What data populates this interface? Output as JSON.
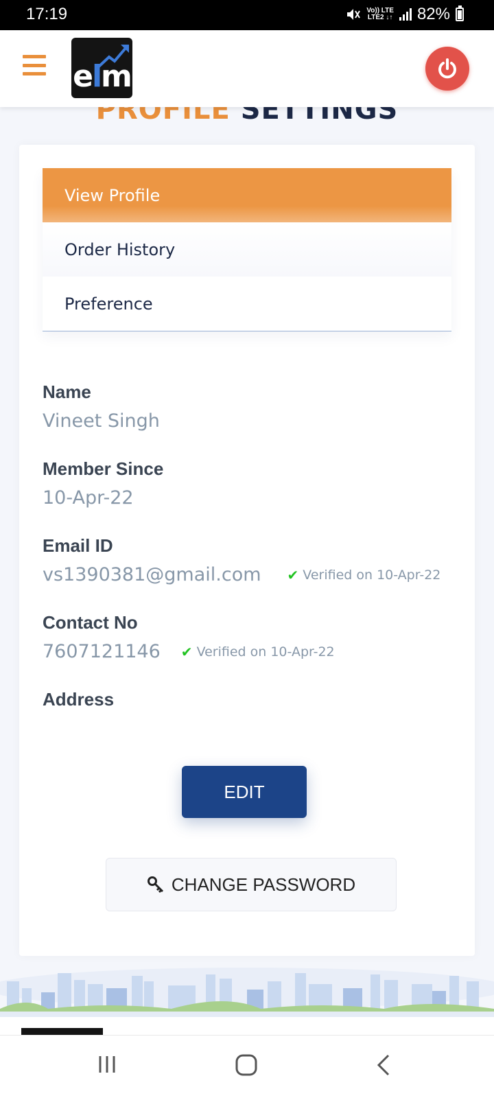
{
  "status_bar": {
    "time": "17:19",
    "network_top": "Vo)) LTE",
    "network_bottom": "LTE2 ↓↑",
    "battery": "82%",
    "battery_level": 0.82
  },
  "header": {
    "logo_text_e": "e",
    "logo_text_l": "l",
    "logo_text_m": "m",
    "menu_icon": "hamburger-icon",
    "power_icon": "power-icon",
    "brand_color": "#e98f3b",
    "power_color": "#e2524a"
  },
  "page": {
    "title_part1": "PROFILE",
    "title_part2": "SETTINGS"
  },
  "tabs": [
    {
      "label": "View Profile",
      "active": true
    },
    {
      "label": "Order History",
      "active": false
    },
    {
      "label": "Preference",
      "active": false
    }
  ],
  "profile": {
    "name_label": "Name",
    "name_value": "Vineet Singh",
    "member_label": "Member Since",
    "member_value": "10-Apr-22",
    "email_label": "Email ID",
    "email_value": "vs1390381@gmail.com",
    "email_verified": "Verified on 10-Apr-22",
    "contact_label": "Contact No",
    "contact_value": "7607121146",
    "contact_verified": "Verified on 10-Apr-22",
    "address_label": "Address"
  },
  "actions": {
    "edit_label": "EDIT",
    "change_password_label": "CHANGE PASSWORD",
    "edit_color": "#1c4488"
  },
  "nav": {
    "recent_icon": "recent-apps-icon",
    "home_icon": "home-icon",
    "back_icon": "back-icon"
  }
}
